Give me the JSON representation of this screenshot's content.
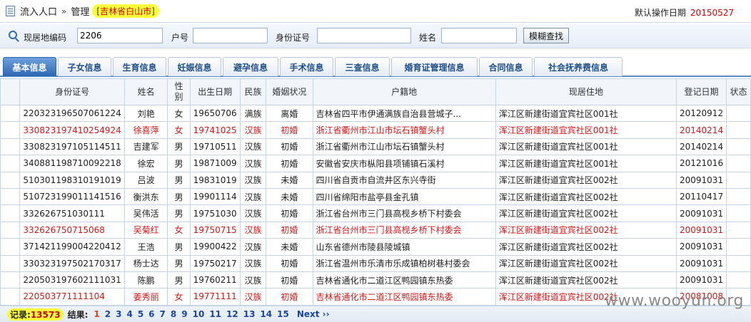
{
  "header": {
    "crumb_1": "流入人口",
    "crumb_sep": "»",
    "crumb_2": "管理",
    "region_bracket_open": "[",
    "region": "吉林省白山市",
    "region_bracket_close": "]",
    "op_date_label": "默认操作日期",
    "op_date_value": "20150527"
  },
  "search": {
    "residence_code_label": "现居地编码",
    "residence_code_value": "2206",
    "household_label": "户号",
    "household_value": "",
    "id_label": "身份证号",
    "id_value": "",
    "name_label": "姓名",
    "name_value": "",
    "button_label": "模糊查找"
  },
  "tabs": [
    {
      "label": "基本信息",
      "active": true
    },
    {
      "label": "子女信息",
      "active": false
    },
    {
      "label": "生育信息",
      "active": false
    },
    {
      "label": "妊娠信息",
      "active": false
    },
    {
      "label": "避孕信息",
      "active": false
    },
    {
      "label": "手术信息",
      "active": false
    },
    {
      "label": "三查信息",
      "active": false
    },
    {
      "label": "婚育证管理信息",
      "active": false
    },
    {
      "label": "合同信息",
      "active": false
    },
    {
      "label": "社会抚养费信息",
      "active": false
    }
  ],
  "table": {
    "headers": [
      "身份证号",
      "姓名",
      "性别",
      "出生日期",
      "民族",
      "婚姻状况",
      "户籍地",
      "现居住地",
      "登记日期",
      "状态"
    ],
    "rows": [
      {
        "id": "220323196507061224",
        "name": "刘艳",
        "sex": "女",
        "birth": "19650706",
        "ethnic": "满族",
        "marital": "离婚",
        "hukou": "吉林省四平市伊通满族自治县营城子...",
        "residence": "浑江区新建街道宜宾社区001社",
        "reg": "20120912",
        "status": "",
        "highlight": false
      },
      {
        "id": "330823197410254924",
        "name": "徐喜萍",
        "sex": "女",
        "birth": "19741025",
        "ethnic": "汉族",
        "marital": "初婚",
        "hukou": "浙江省衢州市江山市坛石镇蟹头村",
        "residence": "浑江区新建街道宜宾社区001社",
        "reg": "20140214",
        "status": "",
        "highlight": true
      },
      {
        "id": "330823197105114511",
        "name": "吉建军",
        "sex": "男",
        "birth": "19710511",
        "ethnic": "汉族",
        "marital": "初婚",
        "hukou": "浙江省衢州市江山市坛石镇蟹头村",
        "residence": "浑江区新建街道宜宾社区001社",
        "reg": "20140214",
        "status": "",
        "highlight": false
      },
      {
        "id": "340881198710092218",
        "name": "徐宏",
        "sex": "男",
        "birth": "19871009",
        "ethnic": "汉族",
        "marital": "初婚",
        "hukou": "安徽省安庆市枞阳县项铺镇石溪村",
        "residence": "浑江区新建街道宜宾社区001社",
        "reg": "20121016",
        "status": "",
        "highlight": false
      },
      {
        "id": "510301198310191019",
        "name": "吕波",
        "sex": "男",
        "birth": "19831019",
        "ethnic": "汉族",
        "marital": "未婚",
        "hukou": "四川省自贡市自流井区东兴寺街",
        "residence": "浑江区新建街道宜宾社区002社",
        "reg": "20091031",
        "status": "",
        "highlight": false
      },
      {
        "id": "510723199011141516",
        "name": "衡洪东",
        "sex": "男",
        "birth": "19901114",
        "ethnic": "汉族",
        "marital": "未婚",
        "hukou": "四川省绵阳市盐亭县金孔镇",
        "residence": "浑江区新建街道宜宾社区002社",
        "reg": "20110417",
        "status": "",
        "highlight": false
      },
      {
        "id": "332626751030111",
        "name": "吴伟活",
        "sex": "男",
        "birth": "19751030",
        "ethnic": "汉族",
        "marital": "初婚",
        "hukou": "浙江省台州市三门县高枧乡桥下村委会",
        "residence": "浑江区新建街道宜宾社区002社",
        "reg": "20091031",
        "status": "",
        "highlight": false
      },
      {
        "id": "332626750715068",
        "name": "吴菊红",
        "sex": "女",
        "birth": "19750715",
        "ethnic": "汉族",
        "marital": "初婚",
        "hukou": "浙江省台州市三门县高枧乡桥下村委会",
        "residence": "浑江区新建街道宜宾社区002社",
        "reg": "20091031",
        "status": "",
        "highlight": true
      },
      {
        "id": "371421199004220412",
        "name": "王浩",
        "sex": "男",
        "birth": "19900422",
        "ethnic": "汉族",
        "marital": "未婚",
        "hukou": "山东省德州市陵县陵城镇",
        "residence": "浑江区新建街道宜宾社区002社",
        "reg": "20091031",
        "status": "",
        "highlight": false
      },
      {
        "id": "330323197502170317",
        "name": "杨士达",
        "sex": "男",
        "birth": "19750217",
        "ethnic": "汉族",
        "marital": "初婚",
        "hukou": "浙江省温州市乐清市乐成镇柏树巷村委会",
        "residence": "浑江区新建街道宜宾社区002社",
        "reg": "20091031",
        "status": "",
        "highlight": false
      },
      {
        "id": "220503197602111031",
        "name": "陈鹏",
        "sex": "男",
        "birth": "19760211",
        "ethnic": "汉族",
        "marital": "初婚",
        "hukou": "吉林省通化市二道江区鸭园镇东热委",
        "residence": "浑江区新建街道宜宾社区002社",
        "reg": "20091031",
        "status": "",
        "highlight": false
      },
      {
        "id": "220503771111104",
        "name": "姜秀丽",
        "sex": "女",
        "birth": "19771111",
        "ethnic": "汉族",
        "marital": "初婚",
        "hukou": "吉林省通化市二道江区鸭园镇东热委",
        "residence": "浑江区新建街道宜宾社区002社",
        "reg": "20081008",
        "status": "",
        "highlight": true
      }
    ]
  },
  "pager": {
    "records_label": "记录:",
    "records_count": "13573",
    "result_label": "结果:",
    "current_page": "1",
    "pages": [
      "2",
      "3",
      "4",
      "5",
      "6",
      "7",
      "8",
      "9",
      "10",
      "11",
      "12",
      "13",
      "14",
      "15"
    ],
    "next_label": "Next ››"
  },
  "watermark": "www.wooyun.org"
}
